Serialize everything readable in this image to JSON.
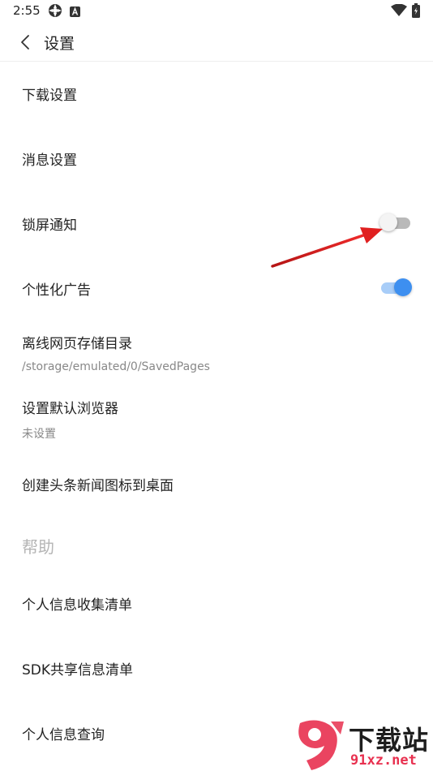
{
  "status_bar": {
    "time": "2:55",
    "icons": [
      "photos-icon",
      "a-icon",
      "wifi-icon",
      "battery-icon"
    ]
  },
  "header": {
    "title": "设置"
  },
  "settings": {
    "download": "下载设置",
    "message": "消息设置",
    "lock_screen_notify": {
      "label": "锁屏通知",
      "enabled": false
    },
    "personal_ads": {
      "label": "个性化广告",
      "enabled": true
    },
    "offline_dir": {
      "label": "离线网页存储目录",
      "value": "/storage/emulated/0/SavedPages"
    },
    "default_browser": {
      "label": "设置默认浏览器",
      "value": "未设置"
    },
    "create_shortcut": "创建头条新闻图标到桌面"
  },
  "help": {
    "section_title": "帮助",
    "items": [
      "个人信息收集清单",
      "SDK共享信息清单",
      "个人信息查询"
    ]
  },
  "watermark": {
    "logo_text": "9",
    "name": "下载站",
    "url": "91xz.net"
  },
  "colors": {
    "accent": "#3d8ff0",
    "accent_track": "#a8cdf8",
    "annotation_arrow": "#d91d1d",
    "watermark_red": "#e8304f"
  }
}
